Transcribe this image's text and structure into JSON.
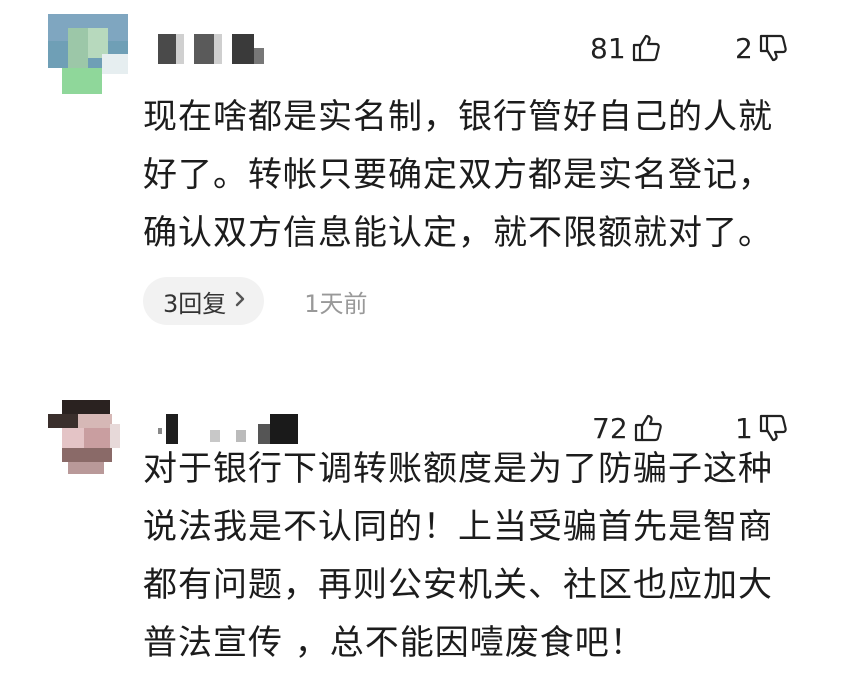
{
  "comments": [
    {
      "likes": "81",
      "dislikes": "2",
      "lines": [
        "现在啥都是实名制，银行管好自己的人就",
        "好了。转帐只要确定双方都是实名登记，",
        "确认双方信息能认定，就不限额就对了。"
      ],
      "replies_label": "3回复",
      "time": "1天前"
    },
    {
      "likes": "72",
      "dislikes": "1",
      "lines": [
        "对于银行下调转账额度是为了防骗子这种",
        "说法我是不认同的！上当受骗首先是智商",
        "都有问题，再则公安机关、社区也应加大",
        "普法宣传 ，总不能因噎废食吧！"
      ]
    }
  ],
  "icons": {
    "like": "thumb-up-icon",
    "dislike": "thumb-down-icon",
    "chevron": "chevron-right-icon"
  },
  "colors": {
    "pill_bg": "#f2f2f2",
    "time_text": "#999999"
  }
}
